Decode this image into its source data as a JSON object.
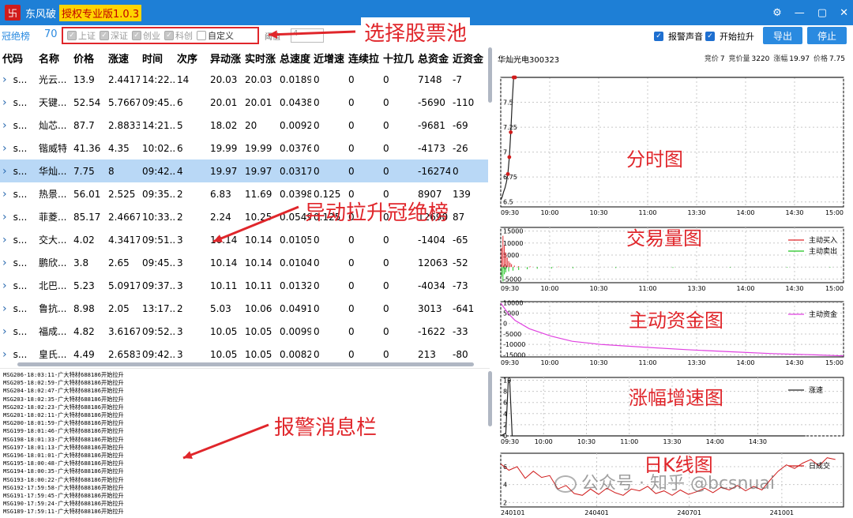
{
  "window": {
    "app_name": "东风破",
    "version": "授权专业版1.0.3",
    "logo_glyph": "卐",
    "controls": [
      "⚙",
      "—",
      "▢",
      "✕"
    ]
  },
  "toolbar": {
    "champ_label": "冠绝榜",
    "champ_count": "70",
    "pool": [
      {
        "label": "上证",
        "checked": true
      },
      {
        "label": "深证",
        "checked": true
      },
      {
        "label": "创业",
        "checked": true
      },
      {
        "label": "科创",
        "checked": true
      },
      {
        "label": "自定义",
        "checked": false
      }
    ],
    "threshold_label": "阈值",
    "threshold_value": "4",
    "alarm_sound": "报警声音",
    "start_rise": "开始拉升",
    "export_button": "导出",
    "stop_button": "停止"
  },
  "table": {
    "headers": [
      "代码",
      "名称",
      "价格",
      "涨速",
      "时间",
      "次序",
      "异动涨",
      "实时涨",
      "总速度",
      "近增速",
      "连续拉",
      "十拉几",
      "总资金",
      "近资金"
    ],
    "selected_row": 4,
    "rows": [
      [
        "s...",
        "光云...",
        "13.9",
        "2.4417",
        "14:22...",
        "14",
        "20.03",
        "20.03",
        "0.0189",
        "0",
        "0",
        "0",
        "7148",
        "-7"
      ],
      [
        "s...",
        "天键...",
        "52.54",
        "5.7667",
        "09:45...",
        "6",
        "20.01",
        "20.01",
        "0.0438",
        "0",
        "0",
        "0",
        "-5690",
        "-110"
      ],
      [
        "s...",
        "灿芯...",
        "87.7",
        "2.8833",
        "14:21...",
        "5",
        "18.02",
        "20",
        "0.0092",
        "0",
        "0",
        "0",
        "-9681",
        "-69"
      ],
      [
        "s...",
        "锴威特",
        "41.36",
        "4.35",
        "10:02...",
        "6",
        "19.99",
        "19.99",
        "0.0376",
        "0",
        "0",
        "0",
        "-4173",
        "-26"
      ],
      [
        "s...",
        "华灿...",
        "7.75",
        "8",
        "09:42...",
        "4",
        "19.97",
        "19.97",
        "0.0317",
        "0",
        "0",
        "0",
        "-16274",
        "0"
      ],
      [
        "s...",
        "热景...",
        "56.01",
        "2.525",
        "09:35...",
        "2",
        "6.83",
        "11.69",
        "0.0398",
        "0.125",
        "0",
        "0",
        "8907",
        "139"
      ],
      [
        "s...",
        "菲菱...",
        "85.17",
        "2.4667",
        "10:33...",
        "2",
        "2.24",
        "10.25",
        "0.0549",
        "0.125",
        "0",
        "0",
        "12690",
        "87"
      ],
      [
        "s...",
        "交大...",
        "4.02",
        "4.3417",
        "09:51...",
        "3",
        "10.14",
        "10.14",
        "0.0105",
        "0",
        "0",
        "0",
        "-1404",
        "-65"
      ],
      [
        "s...",
        "鹏欣...",
        "3.8",
        "2.65",
        "09:45...",
        "3",
        "10.14",
        "10.14",
        "0.0104",
        "0",
        "0",
        "0",
        "12063",
        "-52"
      ],
      [
        "s...",
        "北巴...",
        "5.23",
        "5.0917",
        "09:37...",
        "3",
        "10.11",
        "10.11",
        "0.0132",
        "0",
        "0",
        "0",
        "-4034",
        "-73"
      ],
      [
        "s...",
        "鲁抗...",
        "8.98",
        "2.05",
        "13:17...",
        "2",
        "5.03",
        "10.06",
        "0.0491",
        "0",
        "0",
        "0",
        "3013",
        "-641"
      ],
      [
        "s...",
        "福成...",
        "4.82",
        "3.6167",
        "09:52...",
        "3",
        "10.05",
        "10.05",
        "0.0099",
        "0",
        "0",
        "0",
        "-1622",
        "-33"
      ],
      [
        "s...",
        "皇氏...",
        "4.49",
        "2.6583",
        "09:42...",
        "3",
        "10.05",
        "10.05",
        "0.0082",
        "0",
        "0",
        "0",
        "213",
        "-80"
      ]
    ]
  },
  "messages": [
    "MSG206-18:03:11-广大特材688186开始拉升",
    "MSG205-18:02:59-广大特材688186开始拉升",
    "MSG204-18:02:47-广大特材688186开始拉升",
    "MSG203-18:02:35-广大特材688186开始拉升",
    "MSG202-18:02:23-广大特材688186开始拉升",
    "MSG201-18:02:11-广大特材688186开始拉升",
    "MSG200-18:01:59-广大特材688186开始拉升",
    "MSG199-18:01:46-广大特材688186开始拉升",
    "MSG198-18:01:33-广大特材688186开始拉升",
    "MSG197-18:01:13-广大特材688186开始拉升",
    "MSG196-18:01:01-广大特材688186开始拉升",
    "MSG195-18:00:48-广大特材688186开始拉升",
    "MSG194-18:00:35-广大特材688186开始拉升",
    "MSG193-18:00:22-广大特材688186开始拉升",
    "MSG192-17:59:58-广大特材688186开始拉升",
    "MSG191-17:59:45-广大特材688186开始拉升",
    "MSG190-17:59:24-广大特材688186开始拉升",
    "MSG189-17:59:11-广大特材688186开始拉升"
  ],
  "detail": {
    "stock_name": "华灿光电300323",
    "quote": {
      "bid_label": "竞价",
      "bid": "7",
      "bid_vol_label": "竞价量",
      "bid_vol": "3220",
      "change_label": "涨幅",
      "change": "19.97",
      "price_label": "价格",
      "price": "7.75"
    }
  },
  "annotations": {
    "select_pool": "选择股票池",
    "champ_list": "异动拉升冠绝榜",
    "alert_bar": "报警消息栏"
  },
  "chart_titles": {
    "intraday": "分时图",
    "volume": "交易量图",
    "capital": "主动资金图",
    "speed": "涨幅增速图",
    "kline": "日K线图"
  },
  "watermark": "公众号 · 知乎 @bcsnuai",
  "colors": {
    "accent": "#1e7fd6",
    "annotation": "#e0262b",
    "selected_row": "#b9d8f6",
    "buy": "#e0262b",
    "sell": "#1ec41e",
    "capital": "#e040e0"
  },
  "chart_data": [
    {
      "type": "line",
      "title": "分时图",
      "x_ticks": [
        "09:30",
        "10:00",
        "10:30",
        "11:00",
        "13:30",
        "14:00",
        "14:30",
        "15:00"
      ],
      "y_ticks": [
        6.5,
        6.75,
        7,
        7.25,
        7.5
      ],
      "ylim": [
        6.45,
        7.75
      ],
      "series": [
        {
          "values": [
            [
              0,
              6.52
            ],
            [
              1,
              6.55
            ],
            [
              2,
              6.6
            ],
            [
              3,
              6.64
            ],
            [
              4,
              6.7
            ],
            [
              5,
              6.78
            ],
            [
              6,
              6.95
            ],
            [
              7,
              7.2
            ],
            [
              8,
              7.5
            ],
            [
              9,
              7.75
            ],
            [
              10,
              7.75
            ],
            [
              240,
              7.75
            ]
          ]
        }
      ],
      "markers": [
        [
          5,
          6.78
        ],
        [
          6,
          6.95
        ],
        [
          7,
          7.2
        ],
        [
          9,
          7.75
        ],
        [
          10,
          7.75
        ]
      ]
    },
    {
      "type": "bar",
      "title": "交易量图",
      "x_ticks": [
        "09:30",
        "10:00",
        "10:30",
        "11:00",
        "13:30",
        "14:00",
        "14:30",
        "15:00"
      ],
      "y_ticks": [
        15000,
        10000,
        5000,
        0,
        -5000
      ],
      "ylim": [
        -6500,
        16500
      ],
      "series": [
        {
          "name": "主动买入",
          "values": [
            [
              0,
              8000
            ],
            [
              1,
              13000
            ],
            [
              2,
              9000
            ],
            [
              3,
              6000
            ],
            [
              4,
              4000
            ],
            [
              5,
              2500
            ],
            [
              6,
              1800
            ],
            [
              7,
              1200
            ],
            [
              9,
              600
            ],
            [
              12,
              400
            ],
            [
              20,
              300
            ],
            [
              40,
              200
            ]
          ]
        },
        {
          "name": "主动卖出",
          "values": [
            [
              0,
              -4000
            ],
            [
              1,
              -6000
            ],
            [
              2,
              -3000
            ],
            [
              3,
              -2200
            ],
            [
              5,
              -1800
            ],
            [
              8,
              -1500
            ],
            [
              12,
              -1200
            ],
            [
              18,
              -900
            ],
            [
              25,
              -700
            ],
            [
              35,
              -600
            ],
            [
              50,
              -500
            ],
            [
              80,
              -400
            ],
            [
              120,
              -350
            ],
            [
              160,
              -300
            ],
            [
              200,
              -250
            ],
            [
              230,
              -220
            ]
          ]
        }
      ]
    },
    {
      "type": "line",
      "title": "主动资金图",
      "x_ticks": [
        "09:30",
        "10:00",
        "10:30",
        "11:00",
        "13:30",
        "14:00",
        "14:30",
        "15:00"
      ],
      "y_ticks": [
        10000,
        5000,
        0,
        -5000,
        -10000,
        -15000
      ],
      "ylim": [
        -16000,
        10500
      ],
      "series": [
        {
          "name": "主动资金",
          "values": [
            [
              0,
              9800
            ],
            [
              5,
              5000
            ],
            [
              10,
              1500
            ],
            [
              20,
              -2500
            ],
            [
              35,
              -6000
            ],
            [
              50,
              -8500
            ],
            [
              70,
              -10000
            ],
            [
              100,
              -11300
            ],
            [
              130,
              -12500
            ],
            [
              160,
              -13500
            ],
            [
              190,
              -14400
            ],
            [
              220,
              -15000
            ],
            [
              240,
              -15500
            ]
          ]
        }
      ]
    },
    {
      "type": "line",
      "title": "涨幅增速图",
      "x_ticks": [
        "09:30",
        "10:00",
        "10:30",
        "11:00",
        "13:30",
        "14:00",
        "14:30"
      ],
      "y_ticks": [
        0,
        2,
        4,
        6,
        8,
        10
      ],
      "ylim": [
        0,
        10.5
      ],
      "series": [
        {
          "name": "涨速",
          "values": [
            [
              0,
              0
            ],
            [
              4,
              0.5
            ],
            [
              6,
              10
            ],
            [
              7,
              10
            ],
            [
              9,
              0
            ],
            [
              240,
              0
            ]
          ]
        }
      ]
    },
    {
      "type": "line",
      "title": "日K线图",
      "x_ticks": [
        "240101",
        "240401",
        "240701",
        "241001"
      ],
      "y_ticks": [
        2,
        4,
        6
      ],
      "ylim": [
        1.5,
        7.5
      ],
      "series": [
        {
          "name": "日成交",
          "values": [
            [
              0,
              6.3
            ],
            [
              5,
              5.6
            ],
            [
              10,
              6.0
            ],
            [
              15,
              4.7
            ],
            [
              20,
              5.5
            ],
            [
              25,
              4.8
            ],
            [
              30,
              5.0
            ],
            [
              35,
              3.5
            ],
            [
              40,
              3.9
            ],
            [
              45,
              3.0
            ],
            [
              50,
              2.8
            ],
            [
              55,
              3.5
            ],
            [
              60,
              2.9
            ],
            [
              65,
              3.6
            ],
            [
              70,
              3.1
            ],
            [
              75,
              2.8
            ],
            [
              80,
              3.5
            ],
            [
              85,
              3.3
            ],
            [
              90,
              3.8
            ],
            [
              95,
              3.0
            ],
            [
              100,
              3.3
            ],
            [
              105,
              2.8
            ],
            [
              110,
              3.4
            ],
            [
              115,
              2.9
            ],
            [
              120,
              3.2
            ],
            [
              125,
              3.6
            ],
            [
              130,
              3.1
            ],
            [
              135,
              3.7
            ],
            [
              140,
              3.4
            ],
            [
              145,
              3.9
            ],
            [
              150,
              3.3
            ],
            [
              155,
              3.8
            ],
            [
              160,
              3.4
            ],
            [
              165,
              4.5
            ],
            [
              170,
              5.5
            ],
            [
              175,
              6.2
            ],
            [
              180,
              5.8
            ],
            [
              185,
              6.4
            ],
            [
              190,
              6.8
            ],
            [
              195,
              6.1
            ],
            [
              200,
              7.0
            ],
            [
              205,
              6.8
            ]
          ]
        }
      ]
    }
  ]
}
